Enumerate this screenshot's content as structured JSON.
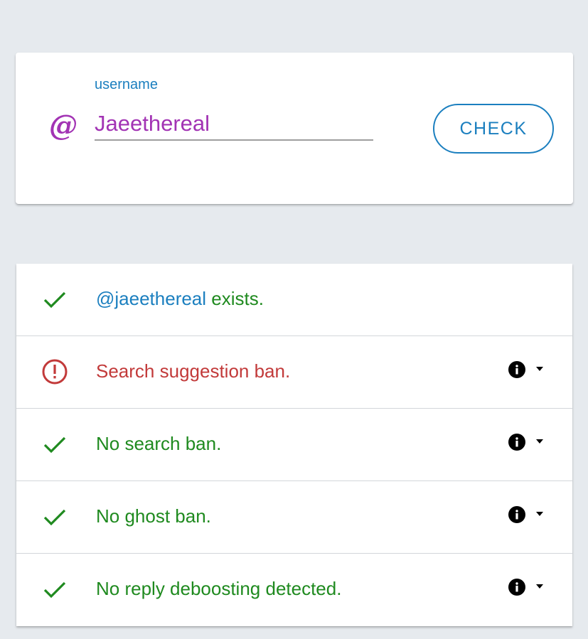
{
  "search": {
    "label": "username",
    "value": "Jaeethereal",
    "at_symbol": "@",
    "button_label": "CHECK"
  },
  "results": [
    {
      "status": "ok",
      "icon": "check-icon",
      "handle": "@jaeethereal",
      "text": " exists.",
      "has_details": false
    },
    {
      "status": "warning",
      "icon": "alert-circle-icon",
      "handle": "",
      "text": "Search suggestion ban.",
      "has_details": true
    },
    {
      "status": "ok",
      "icon": "check-icon",
      "handle": "",
      "text": "No search ban.",
      "has_details": true
    },
    {
      "status": "ok",
      "icon": "check-icon",
      "handle": "",
      "text": "No ghost ban.",
      "has_details": true
    },
    {
      "status": "ok",
      "icon": "check-icon",
      "handle": "",
      "text": "No reply deboosting detected.",
      "has_details": true
    }
  ],
  "colors": {
    "background": "#e6eaee",
    "accent_blue": "#1b7fbf",
    "username_purple": "#a233b4",
    "ok_green": "#1f8a1f",
    "error_red": "#c23a3a"
  }
}
